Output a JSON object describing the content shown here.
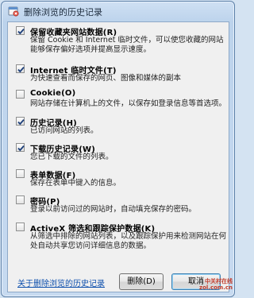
{
  "window": {
    "title": "删除浏览的历史记录"
  },
  "items": [
    {
      "title": "保留收藏夹网站数据(R)",
      "desc": "保留 Cookie 和 Internet 临时文件，可以使您收藏的网站能够保存偏好选项并提高显示速度。",
      "checked": true
    },
    {
      "title": "Internet 临时文件(T)",
      "desc": "为快速查看而保存的网页、图像和媒体的副本",
      "checked": true
    },
    {
      "title": "Cookie(O)",
      "desc": "网站存储在计算机上的文件，以保存如登录信息等首选项。",
      "checked": false
    },
    {
      "title": "历史记录(H)",
      "desc": "已访问网站的列表。",
      "checked": true
    },
    {
      "title": "下载历史记录(W)",
      "desc": "您已下载的文件的列表。",
      "checked": true
    },
    {
      "title": "表单数据(F)",
      "desc": "保存在表单中键入的信息。",
      "checked": false
    },
    {
      "title": "密码(P)",
      "desc": "登录以前访问过的网站时，自动填充保存的密码。",
      "checked": false
    },
    {
      "title": "ActiveX 筛选和跟踪保护数据(K)",
      "desc": "从筛选中排除的网站列表，以及跟踪保护用来检测网站在何处自动共享您访问详细信息的数据。",
      "checked": false
    }
  ],
  "footer": {
    "link": "关于删除浏览的历史记录",
    "delete_button": "删除(D)",
    "cancel_button": "取消"
  },
  "watermark": {
    "line1": "中关村在线",
    "line2": "zol.com.cn"
  },
  "colors": {
    "link": "#0d4fad",
    "checkmark": "#1d3f7a",
    "frame": "#bcd3ec"
  }
}
